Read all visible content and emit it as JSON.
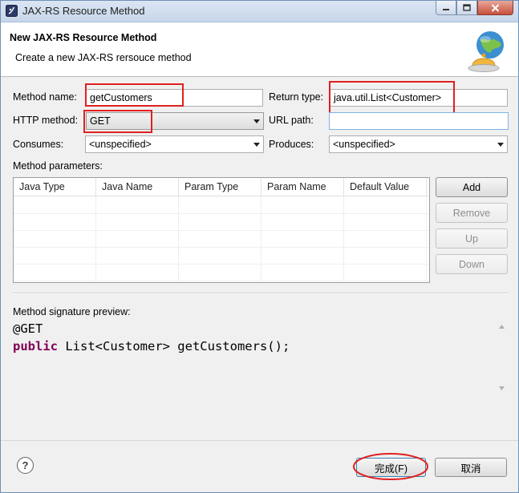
{
  "window": {
    "title": "JAX-RS Resource Method",
    "app_icon": "eclipse-icon",
    "controls": [
      "minimize-icon",
      "maximize-icon",
      "close-icon"
    ]
  },
  "header": {
    "title": "New JAX-RS Resource Method",
    "description": "Create a new JAX-RS rersouce method",
    "banner_icon": "globe-service-bell-icon"
  },
  "form": {
    "method_name_label": "Method name:",
    "method_name_value": "getCustomers",
    "return_type_label": "Return type:",
    "return_type_value": "java.util.List<Customer>",
    "http_method_label": "HTTP method:",
    "http_method_value": "GET",
    "url_path_label": "URL path:",
    "url_path_value": "",
    "consumes_label": "Consumes:",
    "consumes_value": "<unspecified>",
    "produces_label": "Produces:",
    "produces_value": "<unspecified>"
  },
  "params": {
    "label": "Method parameters:",
    "columns": [
      "Java Type",
      "Java Name",
      "Param Type",
      "Param Name",
      "Default Value"
    ],
    "rows": [],
    "buttons": {
      "add": "Add",
      "remove": "Remove",
      "up": "Up",
      "down": "Down"
    }
  },
  "preview": {
    "label": "Method signature preview:",
    "annotation": "@GET",
    "keyword": "public",
    "signature": " List<Customer> getCustomers();"
  },
  "footer": {
    "help_icon": "help-icon",
    "finish": "完成(F)",
    "cancel": "取消"
  },
  "colors": {
    "annotation_red_box": "#e02020",
    "keyword": "#7f0055",
    "title_bar": "#c6d6ea"
  }
}
